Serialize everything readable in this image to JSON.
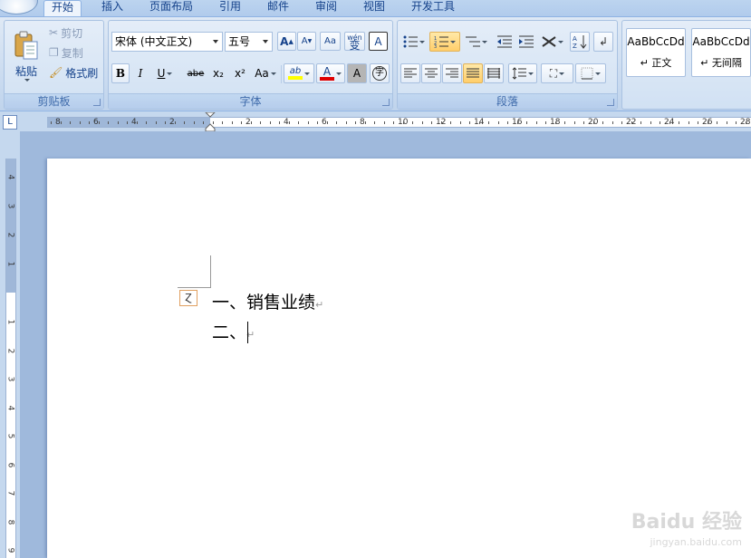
{
  "tabs": [
    "开始",
    "插入",
    "页面布局",
    "引用",
    "邮件",
    "审阅",
    "视图",
    "开发工具"
  ],
  "clipboard": {
    "paste": "粘贴",
    "cut": "剪切",
    "copy": "复制",
    "format_painter": "格式刷",
    "label": "剪贴板"
  },
  "font": {
    "name": "宋体 (中文正文)",
    "size": "五号",
    "label": "字体",
    "grow": "A",
    "shrink": "A",
    "clear": "Aa",
    "pinyin": "wén",
    "border": "A",
    "bold": "B",
    "italic": "I",
    "underline": "U",
    "strike": "abe",
    "sub": "x₂",
    "sup": "x²",
    "case": "Aa",
    "highlight": "ab",
    "color": "A",
    "shade": "A",
    "enclose": "字"
  },
  "paragraph": {
    "label": "段落"
  },
  "styles": [
    {
      "preview": "AaBbCcDd",
      "name": "↵ 正文"
    },
    {
      "preview": "AaBbCcDd",
      "name": "↵ 无间隔"
    }
  ],
  "ruler_button": "L",
  "ruler_numbers_left": [
    "8",
    "6",
    "4",
    "2"
  ],
  "ruler_numbers_right": [
    "2",
    "4",
    "6",
    "8",
    "10",
    "12",
    "14",
    "16",
    "18",
    "20",
    "22",
    "24",
    "26",
    "28"
  ],
  "vruler_numbers": [
    "4",
    "3",
    "2",
    "1",
    "1",
    "2",
    "3",
    "4",
    "5",
    "6",
    "7",
    "8",
    "9"
  ],
  "document": {
    "lines": [
      "一、销售业绩",
      "二、"
    ],
    "para_mark": "↵",
    "autocorrect": "Ɀ"
  },
  "watermark": {
    "brand": "Baidu 经验",
    "url": "jingyan.baidu.com"
  }
}
